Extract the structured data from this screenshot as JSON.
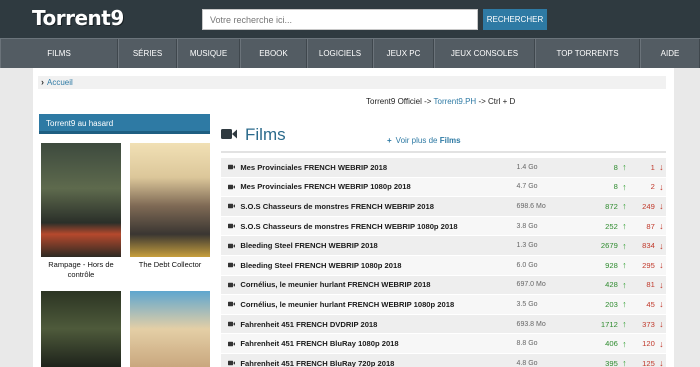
{
  "header": {
    "logo": "Torrent9",
    "search": {
      "placeholder": "Votre recherche ici...",
      "value": ""
    },
    "search_button": "RECHERCHER"
  },
  "nav": {
    "items": [
      "FILMS",
      "SÉRIES",
      "MUSIQUE",
      "EBOOK",
      "LOGICIELS",
      "JEUX PC",
      "JEUX CONSOLES",
      "TOP TORRENTS",
      "AIDE"
    ]
  },
  "breadcrumb": {
    "home": "Accueil"
  },
  "mirror": {
    "prefix": "Torrent9 Officiel ->",
    "link": "Torrent9.PH",
    "suffix": "-> Ctrl + D"
  },
  "sidebar": {
    "title": "Torrent9 au hasard",
    "posters": [
      {
        "title": "Rampage - Hors de contrôle"
      },
      {
        "title": "The Debt Collector"
      },
      {
        "title": ""
      },
      {
        "title": ""
      }
    ]
  },
  "section": {
    "title": "Films",
    "see_more_prefix": "Voir plus de",
    "see_more_bold": "Films"
  },
  "torrents": [
    {
      "name": "Mes Provinciales FRENCH WEBRIP 2018",
      "size": "1.4 Go",
      "seeds": "8",
      "leechers": "1"
    },
    {
      "name": "Mes Provinciales FRENCH WEBRIP 1080p 2018",
      "size": "4.7 Go",
      "seeds": "8",
      "leechers": "2"
    },
    {
      "name": "S.O.S Chasseurs de monstres FRENCH WEBRIP 2018",
      "size": "698.6 Mo",
      "seeds": "872",
      "leechers": "249"
    },
    {
      "name": "S.O.S Chasseurs de monstres FRENCH WEBRIP 1080p 2018",
      "size": "3.8 Go",
      "seeds": "252",
      "leechers": "87"
    },
    {
      "name": "Bleeding Steel FRENCH WEBRIP 2018",
      "size": "1.3 Go",
      "seeds": "2679",
      "leechers": "834"
    },
    {
      "name": "Bleeding Steel FRENCH WEBRIP 1080p 2018",
      "size": "6.0 Go",
      "seeds": "928",
      "leechers": "295"
    },
    {
      "name": "Cornélius, le meunier hurlant FRENCH WEBRIP 2018",
      "size": "697.0 Mo",
      "seeds": "428",
      "leechers": "81"
    },
    {
      "name": "Cornélius, le meunier hurlant FRENCH WEBRIP 1080p 2018",
      "size": "3.5 Go",
      "seeds": "203",
      "leechers": "45"
    },
    {
      "name": "Fahrenheit 451 FRENCH DVDRIP 2018",
      "size": "693.8 Mo",
      "seeds": "1712",
      "leechers": "373"
    },
    {
      "name": "Fahrenheit 451 FRENCH BluRay 1080p 2018",
      "size": "8.8 Go",
      "seeds": "406",
      "leechers": "120"
    },
    {
      "name": "Fahrenheit 451 FRENCH BluRay 720p 2018",
      "size": "4.8 Go",
      "seeds": "395",
      "leechers": "125"
    }
  ],
  "colors": {
    "header_bg": "#2f3a40",
    "nav_bg": "#535c63",
    "accent": "#2e7aa4",
    "seed": "#2e8b2e",
    "leech": "#c0392b"
  }
}
